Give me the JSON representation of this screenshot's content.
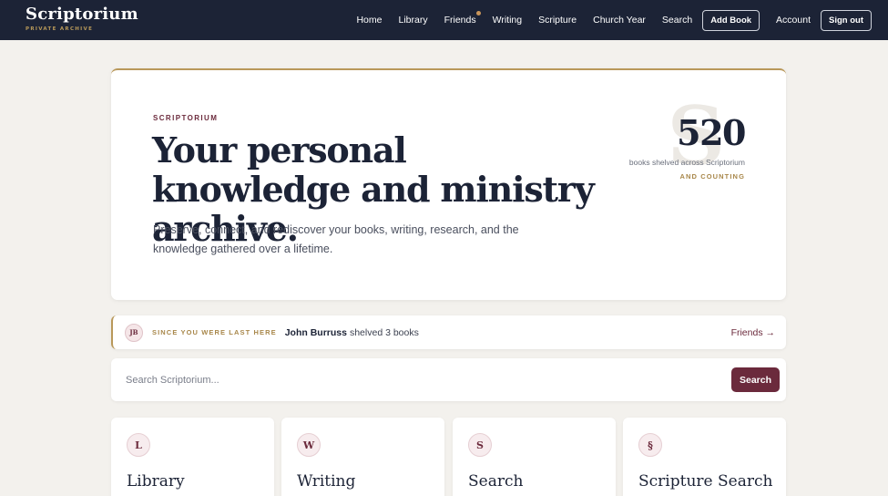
{
  "brand": {
    "name": "Scriptorium",
    "tagline": "PRIVATE ARCHIVE"
  },
  "nav": {
    "home": "Home",
    "library": "Library",
    "friends": "Friends",
    "writing": "Writing",
    "scripture": "Scripture",
    "church_year": "Church Year",
    "search": "Search",
    "add_book": "Add Book",
    "account": "Account",
    "sign_out": "Sign out"
  },
  "hero": {
    "eyebrow": "SCRIPTORIUM",
    "headline": "Your personal knowledge and ministry archive.",
    "lede": "Preserve, connect, and rediscover your books, writing, research, and the knowledge gathered over a lifetime.",
    "stat_watermark": "S",
    "stat_number": "520",
    "stat_label": "books shelved across Scriptorium",
    "stat_sub": "AND COUNTING"
  },
  "activity": {
    "avatar_initials": "JB",
    "since_label": "SINCE YOU WERE LAST HERE",
    "user_name": "John Burruss",
    "message": "shelved 3 books",
    "link_label": "Friends →"
  },
  "search": {
    "placeholder": "Search Scriptorium...",
    "button_label": "Search"
  },
  "cards": [
    {
      "icon": "L",
      "title": "Library"
    },
    {
      "icon": "W",
      "title": "Writing"
    },
    {
      "icon": "S",
      "title": "Search"
    },
    {
      "icon": "§",
      "title": "Scripture Search"
    }
  ],
  "colors": {
    "navy": "#1c2336",
    "accent_gold": "#b9985a",
    "burgundy": "#6b2a3c",
    "background": "#f3f1ed"
  }
}
